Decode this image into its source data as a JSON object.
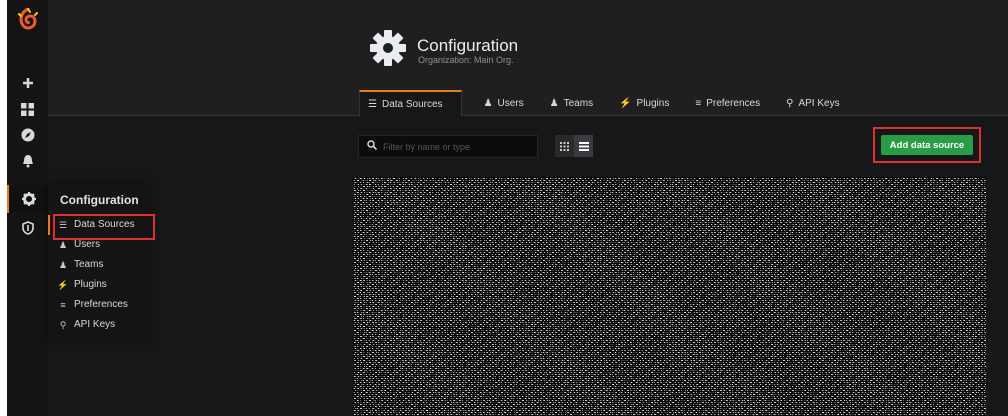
{
  "page": {
    "title": "Configuration",
    "subtitle": "Organization: Main Org."
  },
  "sidemenu": {
    "icons": [
      "grafana-logo-icon",
      "plus-icon",
      "dashboards-icon",
      "explore-icon",
      "bell-icon",
      "gear-icon",
      "shield-icon"
    ]
  },
  "flyout": {
    "header": "Configuration",
    "items": [
      {
        "label": "Data Sources",
        "icon": "database-icon"
      },
      {
        "label": "Users",
        "icon": "user-icon"
      },
      {
        "label": "Teams",
        "icon": "users-icon"
      },
      {
        "label": "Plugins",
        "icon": "plug-icon"
      },
      {
        "label": "Preferences",
        "icon": "sliders-icon"
      },
      {
        "label": "API Keys",
        "icon": "key-icon"
      }
    ]
  },
  "tabs": [
    {
      "label": "Data Sources",
      "icon": "database-icon",
      "active": true
    },
    {
      "label": "Users",
      "icon": "user-icon"
    },
    {
      "label": "Teams",
      "icon": "users-icon"
    },
    {
      "label": "Plugins",
      "icon": "plug-icon"
    },
    {
      "label": "Preferences",
      "icon": "sliders-icon"
    },
    {
      "label": "API Keys",
      "icon": "key-icon"
    }
  ],
  "toolbar": {
    "filter_placeholder": "Filter by name or type",
    "filter_value": "",
    "view_modes": [
      "grid-view-icon",
      "list-view-icon"
    ],
    "add_button": "Add data source"
  },
  "colors": {
    "accent": "#eb7b18",
    "primary_button": "#299c46",
    "highlight_box": "#e02f2f"
  }
}
